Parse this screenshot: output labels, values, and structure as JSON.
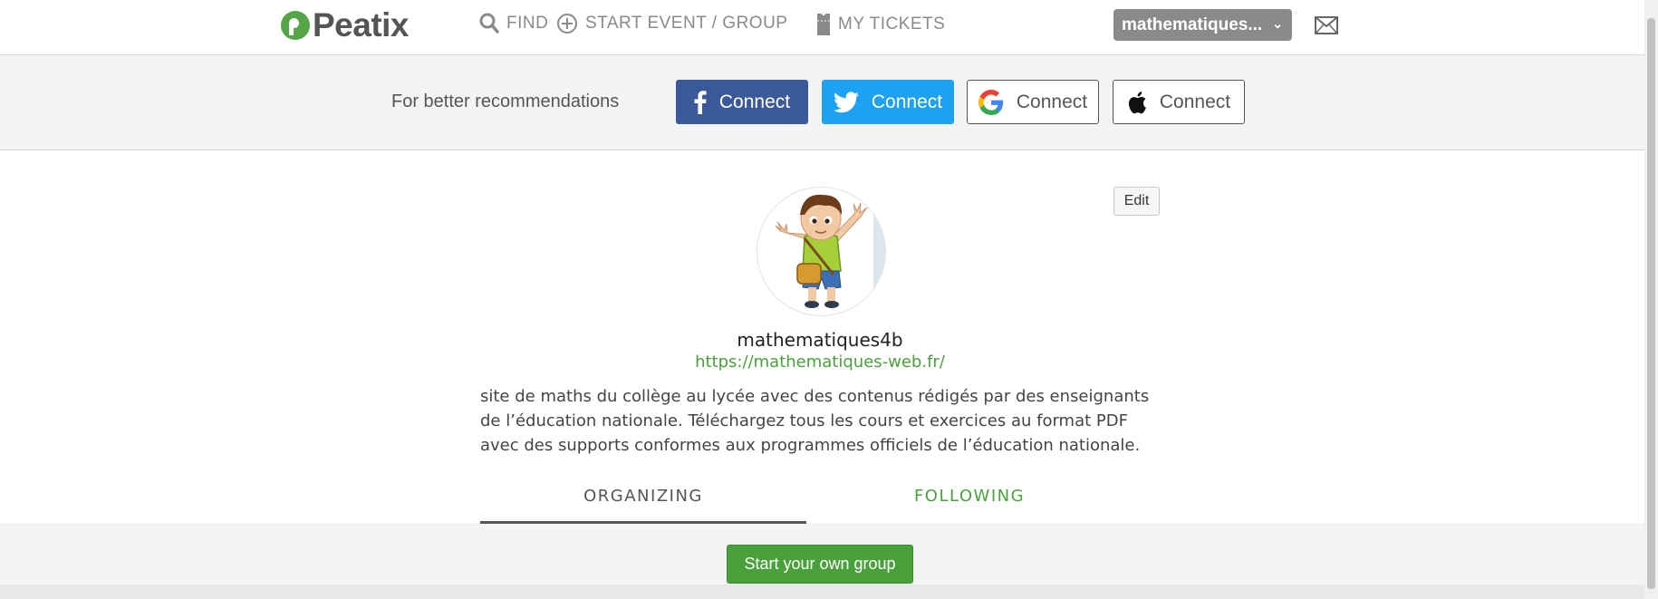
{
  "brand": {
    "name": "Peatix",
    "color": "#55a546"
  },
  "nav": {
    "find": "FIND",
    "start_event": "START EVENT / GROUP",
    "my_tickets": "MY TICKETS"
  },
  "user_menu": {
    "label": "mathematiques..."
  },
  "connect": {
    "prompt": "For better recommendations",
    "facebook": "Connect",
    "twitter": "Connect",
    "google": "Connect",
    "apple": "Connect"
  },
  "profile": {
    "edit": "Edit",
    "username": "mathematiques4b",
    "url": "https://mathematiques-web.fr/",
    "bio_1": "site de maths du collège au lycée avec des contenus rédigés par des enseignants",
    "bio_2": "de l’éducation nationale. Téléchargez tous les cours et exercices au format PDF",
    "bio_3": "avec des supports conformes aux programmes officiels de l’éducation nationale."
  },
  "tabs": {
    "organizing": "ORGANIZING",
    "following": "FOLLOWING"
  },
  "actions": {
    "start_group": "Start your own group"
  }
}
